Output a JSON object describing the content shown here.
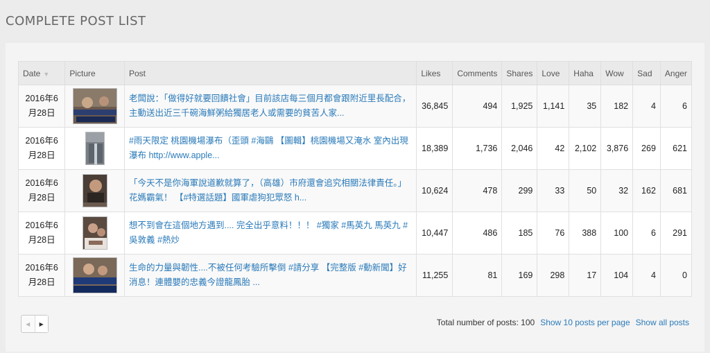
{
  "section_title": "COMPLETE POST LIST",
  "table": {
    "headers": {
      "date": "Date",
      "picture": "Picture",
      "post": "Post",
      "likes": "Likes",
      "comments": "Comments",
      "shares": "Shares",
      "love": "Love",
      "haha": "Haha",
      "wow": "Wow",
      "sad": "Sad",
      "anger": "Anger"
    },
    "sort_icon": "sort-down-icon",
    "rows": [
      {
        "date": "2016年6月28日",
        "post": "老闆說：「做得好就要回饋社會」目前該店每三個月都會跟附近里長配合，主動送出近三千碗海鮮粥給獨居老人或需要的貧苦人家...",
        "likes": "36,845",
        "comments": "494",
        "shares": "1,925",
        "love": "1,141",
        "haha": "35",
        "wow": "182",
        "sad": "4",
        "anger": "6"
      },
      {
        "date": "2016年6月28日",
        "post": "#雨天限定 桃園機場瀑布（歪頭 #海鷗 【圖輯】桃園機場又淹水 室內出現瀑布 http://www.apple...",
        "likes": "18,389",
        "comments": "1,736",
        "shares": "2,046",
        "love": "42",
        "haha": "2,102",
        "wow": "3,876",
        "sad": "269",
        "anger": "621"
      },
      {
        "date": "2016年6月28日",
        "post": "「今天不是你海軍說道歉就算了，（高雄）市府還會追究相關法律責任。」花媽霸氣！ 【#特選話題】國軍虐狗犯眾怒 h...",
        "likes": "10,624",
        "comments": "478",
        "shares": "299",
        "love": "33",
        "haha": "50",
        "wow": "32",
        "sad": "162",
        "anger": "681"
      },
      {
        "date": "2016年6月28日",
        "post": "想不到會在這個地方遇到.... 完全出乎意料！！！ #獨家 #馬英九 馬英九 #吳敦義 #熱炒",
        "likes": "10,447",
        "comments": "486",
        "shares": "185",
        "love": "76",
        "haha": "388",
        "wow": "100",
        "sad": "6",
        "anger": "291"
      },
      {
        "date": "2016年6月28日",
        "post": "生命的力量與韌性....不被任何考驗所擊倒 #請分享 【完整版 #動新聞】好消息！連體嬰的忠義今證龍鳳胎 ...",
        "likes": "11,255",
        "comments": "81",
        "shares": "169",
        "love": "298",
        "haha": "17",
        "wow": "104",
        "sad": "4",
        "anger": "0"
      }
    ]
  },
  "pager": {
    "prev_icon": "chevron-left-icon",
    "next_icon": "chevron-right-icon"
  },
  "footer": {
    "total_text": "Total number of posts: 100",
    "show_10": "Show 10 posts per page",
    "show_all": "Show all posts"
  },
  "colors": {
    "link": "#2a7ab9",
    "background": "#ececec"
  }
}
